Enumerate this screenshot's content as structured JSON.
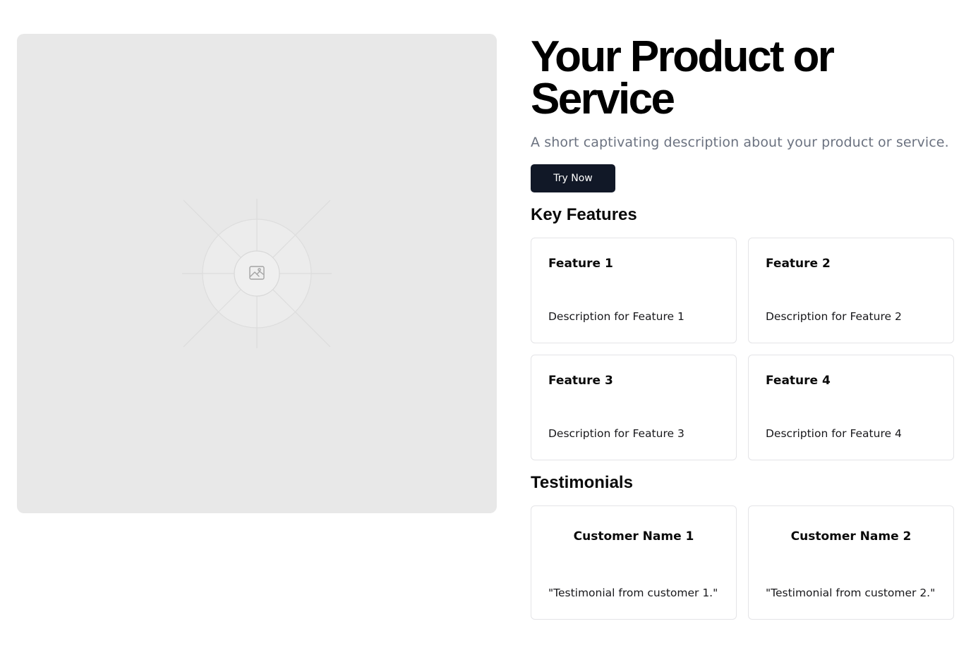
{
  "hero": {
    "image_icon": "image-placeholder-icon",
    "title": "Your Product or Service",
    "subtitle": "A short captivating description about your product or service.",
    "cta_label": "Try Now",
    "cta_color": "#111827",
    "placeholder_color": "#e8e8e8"
  },
  "features": {
    "heading": "Key Features",
    "items": [
      {
        "title": "Feature 1",
        "description": "Description for Feature 1"
      },
      {
        "title": "Feature 2",
        "description": "Description for Feature 2"
      },
      {
        "title": "Feature 3",
        "description": "Description for Feature 3"
      },
      {
        "title": "Feature 4",
        "description": "Description for Feature 4"
      }
    ]
  },
  "testimonials": {
    "heading": "Testimonials",
    "items": [
      {
        "name": "Customer Name 1",
        "quote": "\"Testimonial from customer 1.\""
      },
      {
        "name": "Customer Name 2",
        "quote": "\"Testimonial from customer 2.\""
      }
    ]
  }
}
